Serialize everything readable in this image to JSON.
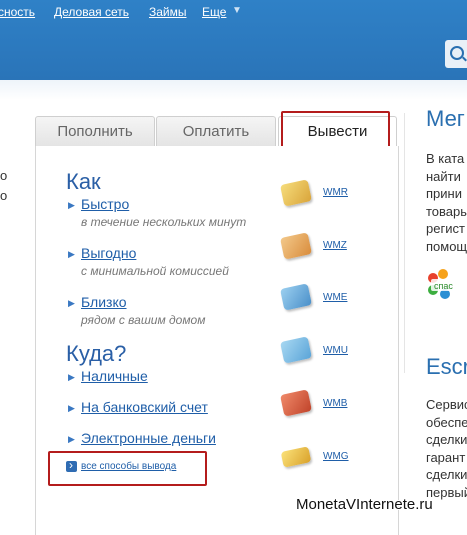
{
  "topnav": {
    "item_1": "сность",
    "item_2": "Деловая сеть",
    "item_3": "Займы",
    "item_4": "Еще",
    "more_icon": "chevron-down-icon"
  },
  "left_cut_text": {
    "line_1": "о",
    "line_2": "о"
  },
  "tabs": {
    "deposit": "Пополнить",
    "pay": "Оплатить",
    "withdraw": "Вывести"
  },
  "how": {
    "heading": "Как",
    "fast": {
      "label": "Быстро",
      "sub": "в течение нескольких минут"
    },
    "cheap": {
      "label": "Выгодно",
      "sub": "с минимальной комиссией"
    },
    "near": {
      "label": "Близко",
      "sub": "рядом с вашим домом"
    }
  },
  "where": {
    "heading": "Куда?",
    "cash": "Наличные",
    "bank": "На банковский счет",
    "emoney": "Электронные деньги",
    "all": "все способы вывода"
  },
  "wallets": [
    "WMR",
    "WMZ",
    "WME",
    "WMU",
    "WMB",
    "WMG"
  ],
  "wallet_colors": [
    "#e8c34a",
    "#e6a94f",
    "#6aa9d8",
    "#6fb7e2",
    "#d6593b",
    "#e6b93a"
  ],
  "right": {
    "heading_1": "Мег",
    "text_1": "В ката\nнайти \nприни\nтовары\nрегист\nпомощ",
    "logo_text": "спас",
    "heading_2": "Escr",
    "text_2": "Сервис\nобеспе\nсделки\nгарант\nсделки\nпервый"
  },
  "watermark": "MonetaVInternete.ru",
  "colors": {
    "accent": "#2a74b8",
    "link": "#1f5ea8",
    "highlight": "#b41c1c"
  }
}
